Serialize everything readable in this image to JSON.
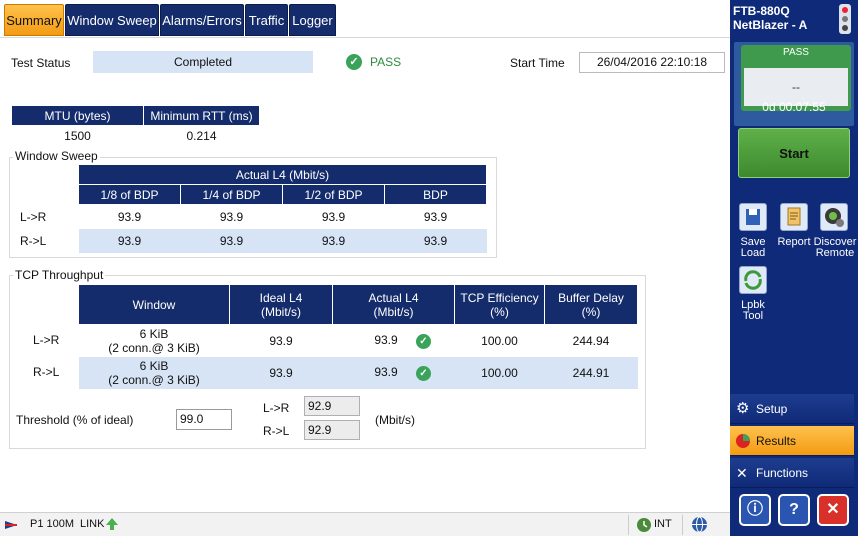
{
  "tabs": [
    {
      "label": "Summary",
      "active": true
    },
    {
      "label": "Window Sweep",
      "active": false
    },
    {
      "label": "Alarms/Errors",
      "active": false
    },
    {
      "label": "Traffic",
      "active": false
    },
    {
      "label": "Logger",
      "active": false
    }
  ],
  "header": {
    "test_status_label": "Test Status",
    "test_status_value": "Completed",
    "verdict": "PASS",
    "start_time_label": "Start Time",
    "start_time_value": "26/04/2016 22:10:18"
  },
  "mtu_table": {
    "headers": [
      "MTU (bytes)",
      "Minimum RTT (ms)"
    ],
    "values": [
      "1500",
      "0.214"
    ]
  },
  "window_sweep": {
    "title": "Window Sweep",
    "group_header": "Actual L4 (Mbit/s)",
    "columns": [
      "1/8 of BDP",
      "1/4 of BDP",
      "1/2 of BDP",
      "BDP"
    ],
    "rows": [
      {
        "label": "L->R",
        "values": [
          "93.9",
          "93.9",
          "93.9",
          "93.9"
        ]
      },
      {
        "label": "R->L",
        "values": [
          "93.9",
          "93.9",
          "93.9",
          "93.9"
        ]
      }
    ]
  },
  "tcp_throughput": {
    "title": "TCP Throughput",
    "headers": [
      "Window",
      "Ideal L4\n(Mbit/s)",
      "Actual L4\n(Mbit/s)",
      "TCP Efficiency\n(%)",
      "Buffer Delay\n(%)"
    ],
    "rows": [
      {
        "label": "L->R",
        "window": "6 KiB\n(2 conn.@ 3 KiB)",
        "ideal": "93.9",
        "actual": "93.9",
        "efficiency": "100.00",
        "buffer_delay": "244.94"
      },
      {
        "label": "R->L",
        "window": "6 KiB\n(2 conn.@ 3 KiB)",
        "ideal": "93.9",
        "actual": "93.9",
        "efficiency": "100.00",
        "buffer_delay": "244.91"
      }
    ],
    "threshold_label": "Threshold (% of ideal)",
    "threshold_value": "99.0",
    "lr_label": "L->R",
    "lr_value": "92.9",
    "rl_label": "R->L",
    "rl_value": "92.9",
    "unit_label": "(Mbit/s)"
  },
  "statusbar": {
    "port": "P1 100M",
    "link": "LINK",
    "clock": "INT"
  },
  "right_panel": {
    "model": "FTB-880Q",
    "product": "NetBlazer - A",
    "verdict": "PASS",
    "sub_verdict": "--",
    "timer": "0d 00:07:55",
    "start_label": "Start",
    "save_load_label": "Save\nLoad",
    "report_label": "Report",
    "discover_label": "Discover\nRemote",
    "lpbk_label": "Lpbk\nTool",
    "nav": [
      {
        "label": "Setup",
        "active": false
      },
      {
        "label": "Results",
        "active": true
      },
      {
        "label": "Functions",
        "active": false
      }
    ]
  },
  "colors": {
    "header_navy": "#142c6b",
    "tab_active": "#f39b12",
    "pass_green": "#3aa35a",
    "panel_blue": "#0f2a78"
  }
}
